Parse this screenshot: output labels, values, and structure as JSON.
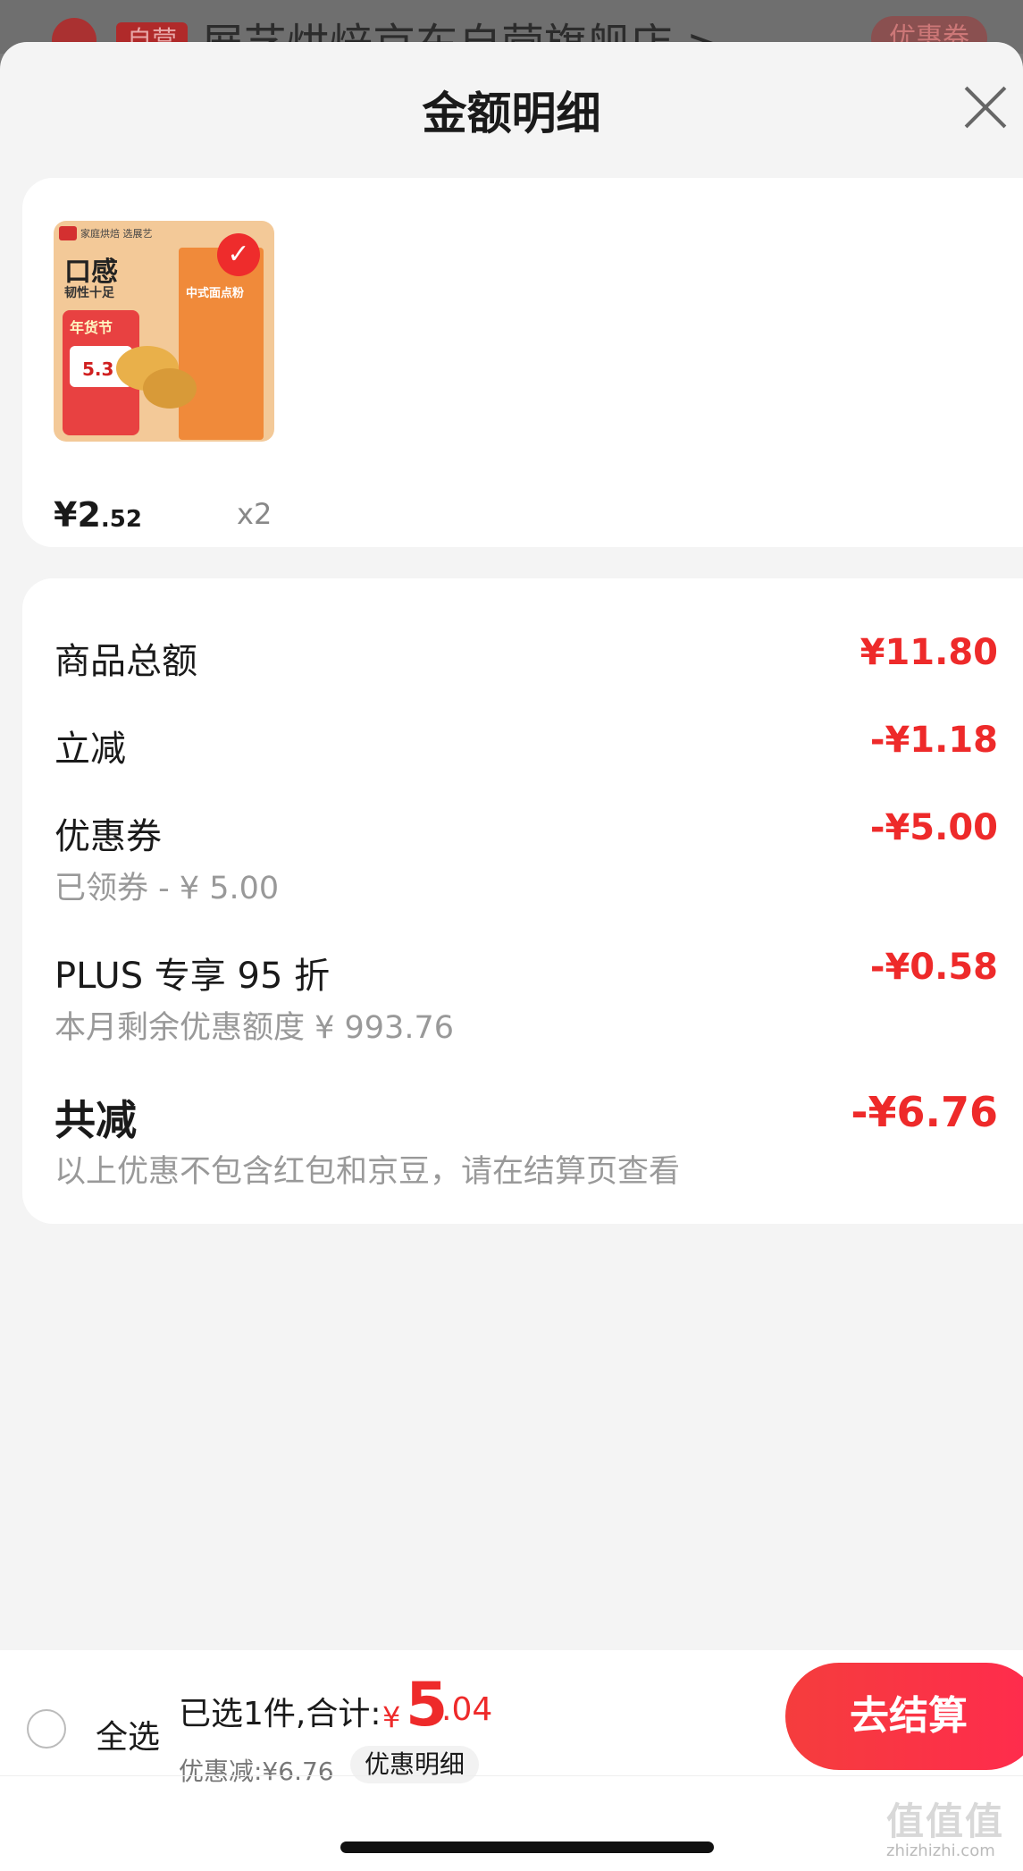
{
  "background": {
    "store_tag": "自营",
    "store_name": "展艺烘焙京东自营旗舰店 >",
    "coupon_label": "优惠券"
  },
  "sheet": {
    "title": "金额明细",
    "close_icon": "close-icon"
  },
  "product": {
    "image": {
      "brand_tag": "家庭烘焙 选展艺",
      "headline": "口感",
      "subline": "韧性十足",
      "festival": "年货节",
      "promo_price": "5.3",
      "bag_label": "中式面点粉"
    },
    "price_main": "¥2",
    "price_decimal": ".52",
    "quantity": "x2"
  },
  "breakdown": {
    "goods_total_label": "商品总额",
    "goods_total_value": "¥11.80",
    "instant_discount_label": "立减",
    "instant_discount_value": "-¥1.18",
    "coupon_label": "优惠券",
    "coupon_sub": "已领券 - ¥ 5.00",
    "coupon_value": "-¥5.00",
    "plus_label": "PLUS 专享 95 折",
    "plus_sub": "本月剩余优惠额度  ¥ 993.76",
    "plus_value": "-¥0.58",
    "total_discount_label": "共减",
    "total_discount_value": "-¥6.76",
    "note": "以上优惠不包含红包和京豆，请在结算页查看"
  },
  "bottom_bar": {
    "select_all": "全选",
    "summary": "已选1件,合计:",
    "total_symbol": "¥",
    "total_int": "5",
    "total_dec": ".04",
    "saved": "优惠减:¥6.76",
    "detail_link": "优惠明细",
    "checkout": "去结算"
  },
  "watermark": {
    "text": "值值值",
    "url": "zhizhizhi.com"
  },
  "colors": {
    "accent": "#ee2a2a",
    "sheet_bg": "#f4f4f4"
  }
}
